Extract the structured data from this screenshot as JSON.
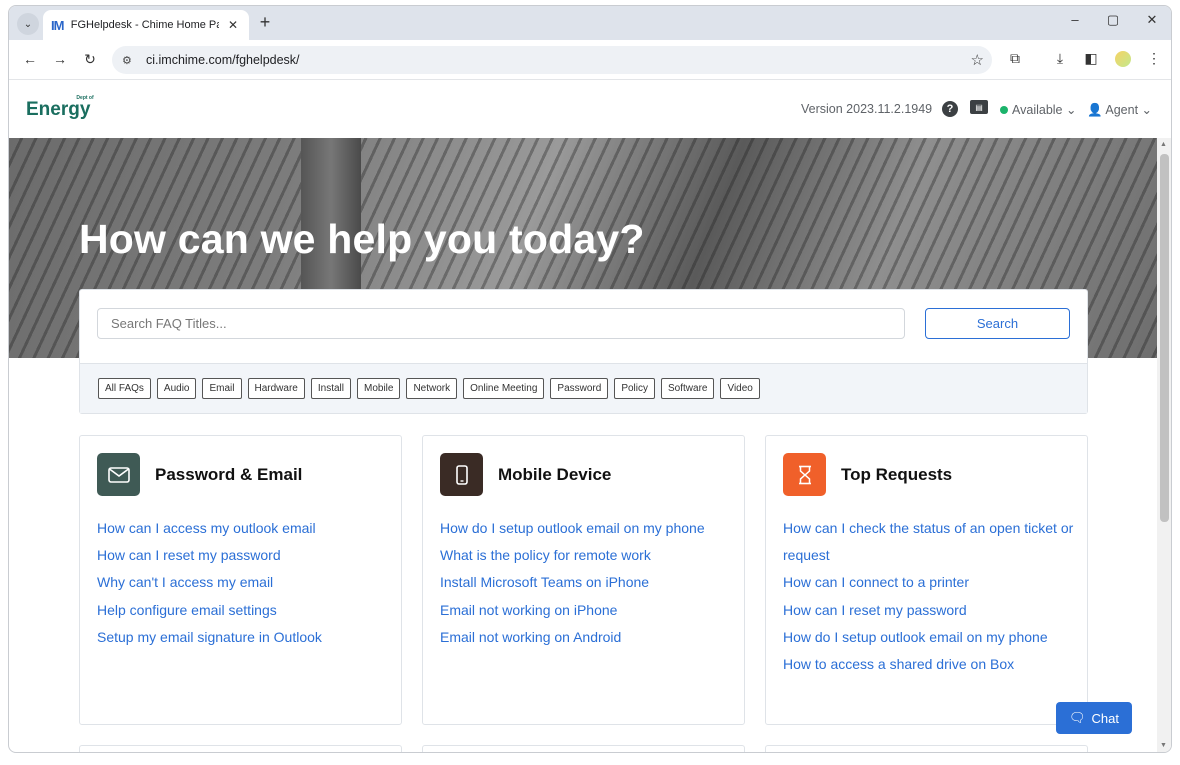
{
  "browser": {
    "tab_title": "FGHelpdesk - Chime Home Pa",
    "tab_favicon_text": "IM",
    "url": "ci.imchime.com/fghelpdesk/"
  },
  "header": {
    "logo_text": "Energy",
    "logo_superscript": "Dept of",
    "version": "Version 2023.11.2.1949",
    "status_label": "Available",
    "agent_label": "Agent"
  },
  "hero": {
    "title": "How can we help you today?"
  },
  "search": {
    "placeholder": "Search FAQ Titles...",
    "button_label": "Search"
  },
  "filters": [
    "All FAQs",
    "Audio",
    "Email",
    "Hardware",
    "Install",
    "Mobile",
    "Network",
    "Online Meeting",
    "Password",
    "Policy",
    "Software",
    "Video"
  ],
  "cards": [
    {
      "title": "Password & Email",
      "icon": "envelope-icon",
      "color": "#3f5a55",
      "links": [
        "How can I access my outlook email",
        "How can I reset my password",
        "Why can't I access my email",
        "Help configure email settings",
        "Setup my email signature in Outlook"
      ]
    },
    {
      "title": "Mobile Device",
      "icon": "mobile-phone-icon",
      "color": "#3a2b25",
      "links": [
        "How do I setup outlook email on my phone",
        "What is the policy for remote work",
        "Install Microsoft Teams on iPhone",
        "Email not working on iPhone",
        "Email not working on Android"
      ]
    },
    {
      "title": "Top Requests",
      "icon": "hourglass-icon",
      "color": "#f0602a",
      "links": [
        "How can I check the status of an open ticket or request",
        "How can I connect to a printer",
        "How can I reset my password",
        "How do I setup outlook email on my phone",
        "How to access a shared drive on Box"
      ]
    }
  ],
  "chat": {
    "label": "Chat"
  },
  "colors": {
    "accent": "#2b6fd6",
    "status_available": "#1bb36b"
  }
}
